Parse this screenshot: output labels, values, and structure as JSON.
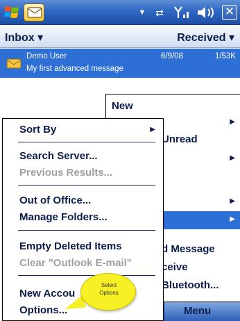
{
  "titlebar": {
    "start_icon": "windows-flag-icon",
    "app_icon": "outlook-envelope-icon",
    "status": {
      "dropdown": "▼",
      "connectivity": "⇄",
      "signal": "Y",
      "volume": "◀€"
    },
    "close_label": "✕"
  },
  "listheader": {
    "folder": "Inbox ▾",
    "sort": "Received ▾"
  },
  "message": {
    "from": "Demo User",
    "date": "6/9/08",
    "size": "1/53K",
    "subject": "My first advanced message"
  },
  "background_menu": {
    "items": [
      {
        "label": "New",
        "has_arrow": false
      },
      {
        "label": "",
        "has_arrow": true
      },
      {
        "label": "Unread",
        "has_arrow": false
      },
      {
        "label": "",
        "has_arrow": true
      },
      {
        "label": "",
        "has_arrow": true
      },
      {
        "label": "",
        "has_arrow": true,
        "highlighted": true
      },
      {
        "label": "d Message",
        "has_arrow": false
      },
      {
        "label": "ceive",
        "has_arrow": false
      },
      {
        "label": "Bluetooth...",
        "has_arrow": false
      }
    ]
  },
  "context_menu": {
    "items": [
      {
        "label": "Sort By",
        "disabled": false,
        "has_arrow": true
      },
      {
        "label": "Search Server...",
        "disabled": false
      },
      {
        "label": "Previous Results...",
        "disabled": true
      },
      {
        "label": "Out of Office...",
        "disabled": false
      },
      {
        "label": "Manage Folders...",
        "disabled": false
      },
      {
        "label": "Empty Deleted Items",
        "disabled": false
      },
      {
        "label": "Clear \"Outlook E-mail\"",
        "disabled": true
      },
      {
        "label": "New Accou",
        "disabled": false
      },
      {
        "label": "Options...",
        "disabled": false
      }
    ],
    "arrow_glyph": "▶"
  },
  "softkey": {
    "menu_label": "Menu"
  },
  "callout": {
    "line1": "Select",
    "line2": "Options"
  },
  "colors": {
    "selection_blue": "#2e6fd6",
    "titlebar_blue": "#2f67c2",
    "menu_text": "#0b1d4a",
    "disabled_text": "#a0a0a0",
    "callout_yellow": "#f6f024"
  }
}
